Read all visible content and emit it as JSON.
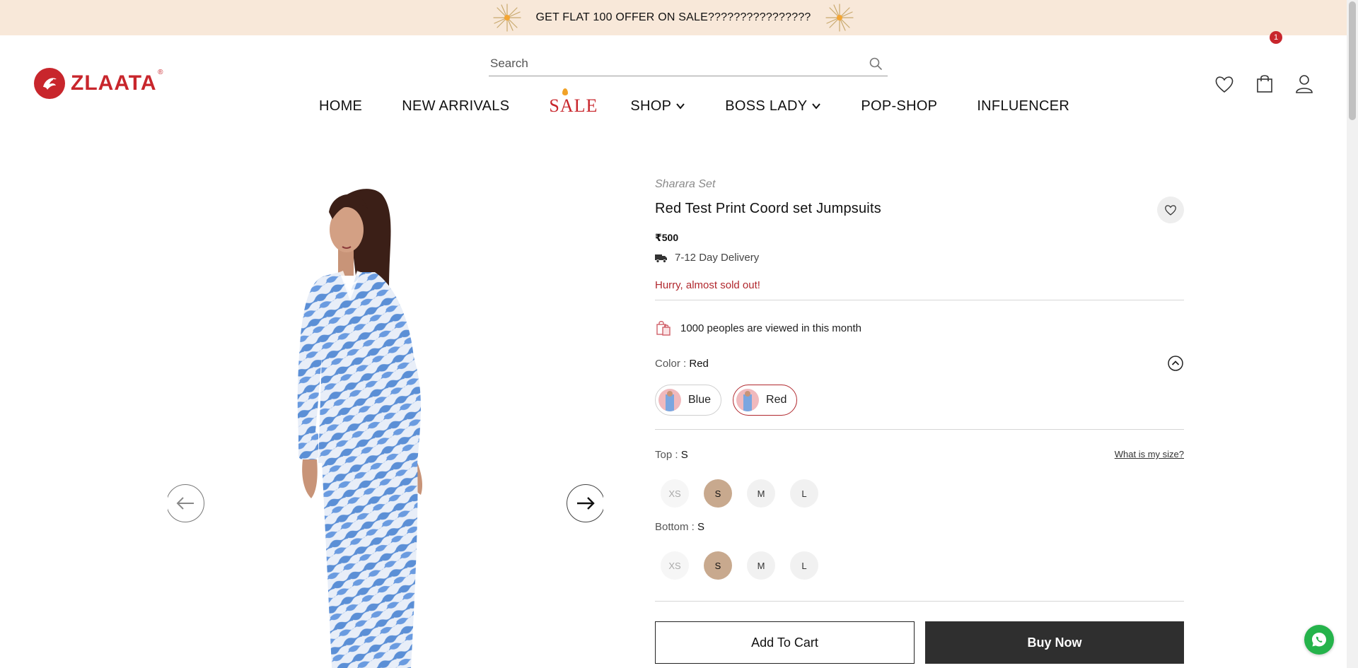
{
  "announcement": {
    "text": "GET FLAT 100 OFFER ON SALE????????????????"
  },
  "brand": {
    "name": "ZLAATA",
    "registered": "®",
    "color": "#c8262c"
  },
  "search": {
    "placeholder": "Search"
  },
  "nav": {
    "items": [
      {
        "label": "HOME"
      },
      {
        "label": "NEW ARRIVALS"
      },
      {
        "label": "SALE"
      },
      {
        "label": "SHOP",
        "dropdown": true
      },
      {
        "label": "BOSS LADY",
        "dropdown": true
      },
      {
        "label": "POP-SHOP"
      },
      {
        "label": "INFLUENCER"
      }
    ]
  },
  "header_icons": {
    "wishlist": "heart-icon",
    "cart": "bag-icon",
    "account": "user-icon",
    "cart_count": "1"
  },
  "product": {
    "category": "Sharara Set",
    "title": "Red Test Print Coord set Jumpsuits",
    "price": "₹500",
    "delivery": "7-12 Day Delivery",
    "stock_message": "Hurry, almost sold out!",
    "views_message": "1000 peoples are viewed in this month",
    "color_label": "Color : ",
    "color_selected": "Red",
    "colors": [
      {
        "label": "Blue",
        "selected": false
      },
      {
        "label": "Red",
        "selected": true
      }
    ],
    "top_label": "Top : ",
    "top_selected": "S",
    "size_guide": "What is my size?",
    "bottom_label": "Bottom : ",
    "bottom_selected": "S",
    "sizes": [
      {
        "label": "XS",
        "state": "disabled"
      },
      {
        "label": "S",
        "state": "selected"
      },
      {
        "label": "M",
        "state": "available"
      },
      {
        "label": "L",
        "state": "available"
      }
    ],
    "add_to_cart": "Add To Cart",
    "buy_now": "Buy Now"
  },
  "colors": {
    "accent": "#c8262c",
    "sold_out_text": "#b1282e",
    "announce_bg": "#f8e8d9",
    "size_selected": "#c8a98e",
    "buy_button": "#2f2f2f",
    "whatsapp": "#25b34b"
  }
}
